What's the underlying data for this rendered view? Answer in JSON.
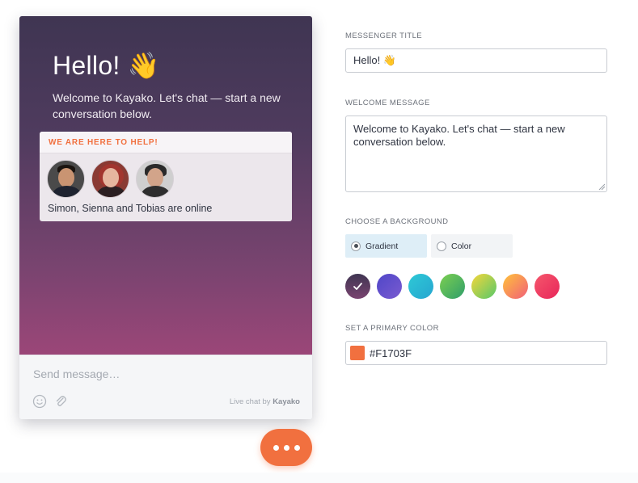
{
  "messenger": {
    "title": "Hello! 👋",
    "welcome": "Welcome to Kayako. Let's chat — start a new conversation below.",
    "help_heading": "WE ARE HERE TO HELP!",
    "online_text": "Simon, Sienna and Tobias are online",
    "send_placeholder": "Send message…",
    "powered_prefix": "Live chat by",
    "powered_brand": "Kayako",
    "gradient_colors": [
      "#3f3552",
      "#9b4678"
    ]
  },
  "settings": {
    "messenger_title_label": "MESSENGER TITLE",
    "messenger_title_value": "Hello! 👋",
    "welcome_label": "WELCOME MESSAGE",
    "welcome_value": "Welcome to Kayako. Let's chat — start a new conversation below.",
    "background_label": "CHOOSE A BACKGROUND",
    "background_options": [
      "Gradient",
      "Color"
    ],
    "background_selected": "Gradient",
    "swatches": [
      "dark-purple",
      "indigo",
      "cyan",
      "green",
      "lime-yellow",
      "orange-pink",
      "red-pink"
    ],
    "swatch_selected": "dark-purple",
    "primary_color_label": "SET A PRIMARY COLOR",
    "primary_color_value": "#F1703F"
  },
  "colors": {
    "accent": "#F1703F",
    "selected_option_bg": "#deeef7"
  }
}
